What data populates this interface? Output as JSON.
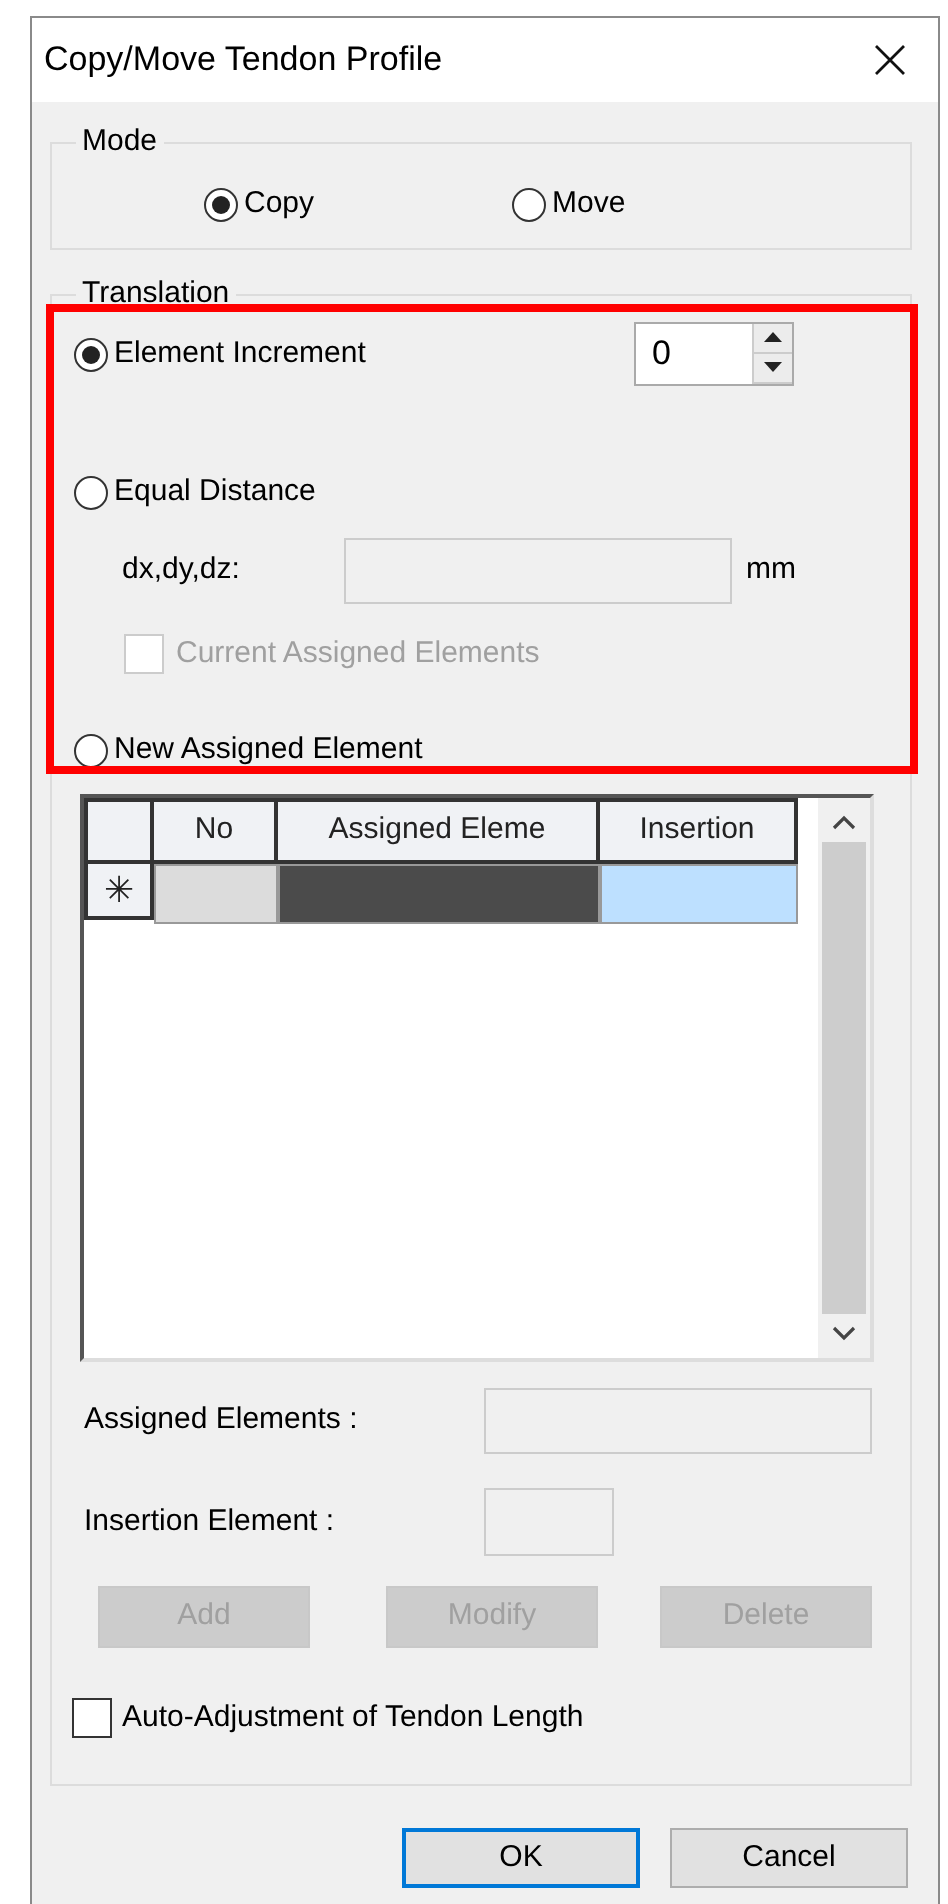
{
  "window": {
    "title": "Copy/Move Tendon Profile"
  },
  "mode": {
    "label": "Mode",
    "options": [
      {
        "label": "Copy",
        "selected": true
      },
      {
        "label": "Move",
        "selected": false
      }
    ]
  },
  "translation": {
    "label": "Translation",
    "options": [
      {
        "label": "Element Increment",
        "selected": true
      },
      {
        "label": "Equal Distance",
        "selected": false
      },
      {
        "label": "New Assigned Element",
        "selected": false
      }
    ],
    "increment": {
      "value": "0"
    },
    "distance": {
      "label": "dx,dy,dz:",
      "unit": "mm",
      "disabled": true
    },
    "current_assigned": {
      "label": "Current Assigned Elements",
      "checked": false,
      "disabled": true
    },
    "table": {
      "columns": [
        "No",
        "Assigned Eleme",
        "Insertion"
      ],
      "new_row_marker": "✳",
      "new_row_cells": [
        {
          "kind": "readonly"
        },
        {
          "kind": "selected"
        },
        {
          "kind": "editable"
        }
      ]
    },
    "assigned_elements": {
      "label": "Assigned Elements :",
      "disabled": true
    },
    "insertion_element": {
      "label": "Insertion Element :",
      "disabled": true
    },
    "actions": [
      {
        "label": "Add",
        "disabled": true
      },
      {
        "label": "Modify",
        "disabled": true
      },
      {
        "label": "Delete",
        "disabled": true
      }
    ],
    "auto_adjust": {
      "label": "Auto-Adjustment of Tendon Length",
      "checked": false
    }
  },
  "buttons": [
    {
      "label": "OK",
      "default": true
    },
    {
      "label": "Cancel",
      "default": false
    }
  ]
}
